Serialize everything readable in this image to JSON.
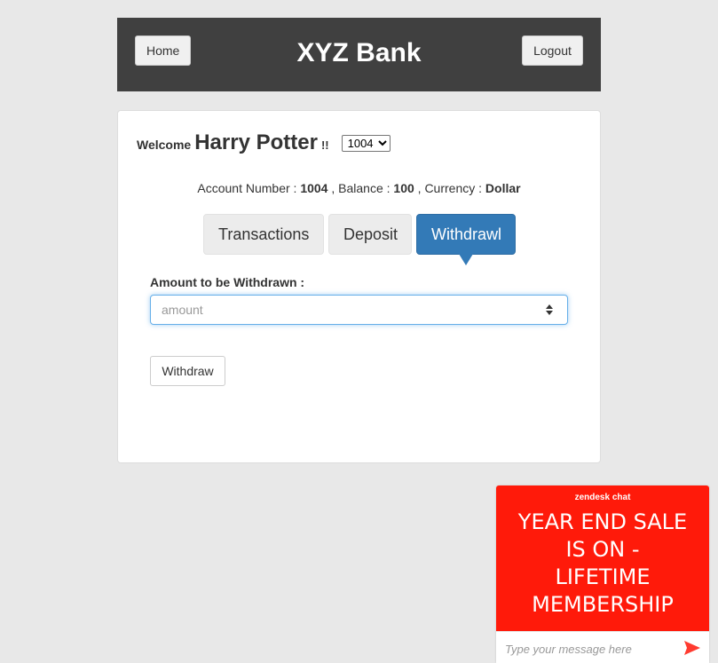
{
  "header": {
    "home_label": "Home",
    "title": "XYZ Bank",
    "logout_label": "Logout",
    "bg_color": "#404040"
  },
  "customer": {
    "welcome_label": "Welcome",
    "name": "Harry Potter",
    "exclaim": "!!",
    "selected_account": "1004",
    "account_options": [
      "1004"
    ]
  },
  "account_info": {
    "number_label": "Account Number :",
    "number": "1004",
    "balance_label": ", Balance :",
    "balance": "100",
    "currency_label": ", Currency :",
    "currency": "Dollar"
  },
  "tabs": [
    {
      "label": "Transactions",
      "active": false
    },
    {
      "label": "Deposit",
      "active": false
    },
    {
      "label": "Withdrawl",
      "active": true
    }
  ],
  "withdraw_form": {
    "amount_label": "Amount to be Withdrawn :",
    "amount_placeholder": "amount",
    "amount_value": "",
    "submit_label": "Withdraw"
  },
  "chat_widget": {
    "brand": "zendesk chat",
    "promo_lines": [
      "YEAR END SALE",
      "IS ON -",
      "LIFETIME",
      "MEMBERSHIP"
    ],
    "input_placeholder": "Type your message here",
    "accent_color": "#ff1a0a"
  },
  "colors": {
    "page_bg": "#e8e8e8",
    "active_tab": "#337ab7",
    "send_icon": "#ff3b30"
  }
}
